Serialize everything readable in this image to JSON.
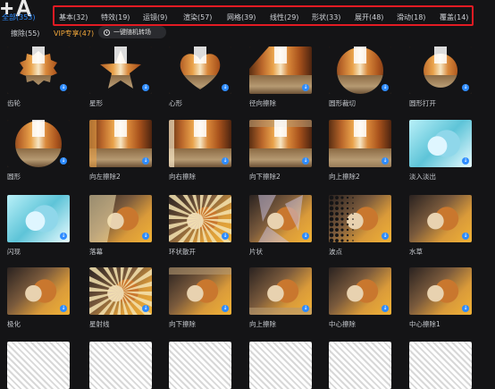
{
  "app": {
    "logo_text": "+A"
  },
  "tabs": [
    {
      "label": "全部(353)",
      "active": true
    },
    {
      "label": "基本(32)"
    },
    {
      "label": "特效(19)"
    },
    {
      "label": "运镜(9)"
    },
    {
      "label": "渲染(57)"
    },
    {
      "label": "网格(39)"
    },
    {
      "label": "线性(29)"
    },
    {
      "label": "形状(33)"
    },
    {
      "label": "展开(48)"
    },
    {
      "label": "滑动(18)"
    },
    {
      "label": "覆盖(14)"
    },
    {
      "label": "擦除(55)"
    },
    {
      "label": "VIP专享(47)",
      "vip": true
    }
  ],
  "random_button": {
    "label": "一键随机转场"
  },
  "transitions": [
    {
      "label": "齿轮",
      "scene": "alley",
      "shape": "gear"
    },
    {
      "label": "星形",
      "scene": "alley",
      "shape": "star"
    },
    {
      "label": "心形",
      "scene": "alley",
      "shape": "heart"
    },
    {
      "label": "径向擦除",
      "scene": "alley",
      "shape": "radial"
    },
    {
      "label": "圆形裁切",
      "scene": "alley",
      "shape": "circle"
    },
    {
      "label": "圆形打开",
      "scene": "alley",
      "shape": "circle-open"
    },
    {
      "label": "圆形",
      "scene": "alley",
      "shape": "oval"
    },
    {
      "label": "向左擦除2",
      "scene": "alley",
      "shape": "wipe-left"
    },
    {
      "label": "向右擦除",
      "scene": "alley",
      "shape": "wipe-right"
    },
    {
      "label": "向下擦除2",
      "scene": "alley",
      "shape": "wipe-down"
    },
    {
      "label": "向上擦除2",
      "scene": "alley",
      "shape": "wipe-up"
    },
    {
      "label": "淡入淡出",
      "scene": "catblue",
      "shape": "none"
    },
    {
      "label": "闪现",
      "scene": "catblue",
      "shape": "none"
    },
    {
      "label": "落幕",
      "scene": "cat",
      "shape": "curtain"
    },
    {
      "label": "环状散开",
      "scene": "cat",
      "shape": "rays"
    },
    {
      "label": "片状",
      "scene": "cat",
      "shape": "shards"
    },
    {
      "label": "波点",
      "scene": "cat",
      "shape": "dots"
    },
    {
      "label": "水草",
      "scene": "cat",
      "shape": "none"
    },
    {
      "label": "极化",
      "scene": "cat",
      "shape": "none"
    },
    {
      "label": "星射线",
      "scene": "cat",
      "shape": "rays"
    },
    {
      "label": "向下擦除",
      "scene": "cat",
      "shape": "wipe-down"
    },
    {
      "label": "向上擦除",
      "scene": "cat",
      "shape": "wipe-up"
    },
    {
      "label": "中心擦除",
      "scene": "cat",
      "shape": "none"
    },
    {
      "label": "中心擦除1",
      "scene": "cat",
      "shape": "none"
    },
    {
      "label": "",
      "scene": "sketch",
      "shape": "none"
    },
    {
      "label": "",
      "scene": "sketch",
      "shape": "none"
    },
    {
      "label": "",
      "scene": "sketch",
      "shape": "none"
    },
    {
      "label": "",
      "scene": "sketch",
      "shape": "none"
    },
    {
      "label": "",
      "scene": "sketch",
      "shape": "none"
    },
    {
      "label": "",
      "scene": "sketch",
      "shape": "none"
    }
  ],
  "colors": {
    "accent": "#2e8cff",
    "vip": "#f0a63a",
    "highlight_box": "#e31b23"
  }
}
